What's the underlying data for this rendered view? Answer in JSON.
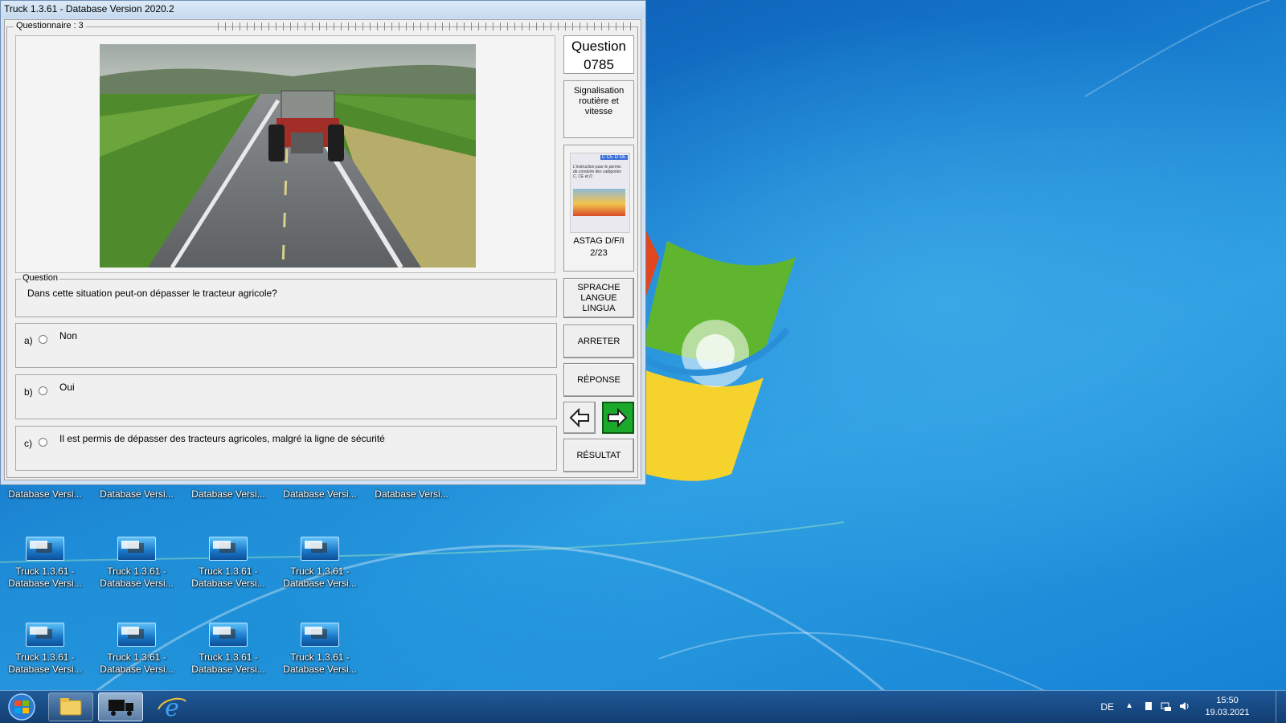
{
  "window": {
    "title": "Truck 1.3.61 - Database Version 2020.2"
  },
  "questionnaire": {
    "legend": "Questionnaire : 3"
  },
  "question_number": {
    "label": "Question",
    "number": "0785"
  },
  "category": {
    "line1": "Signalisation",
    "line2": "routière et vitesse"
  },
  "book": {
    "label_line1": "ASTAG D/F/I",
    "label_line2": "2/23",
    "cover_badge": "C CE D DE",
    "cover_text": "L'instruction pour le permis de conduire des catégories C, CE et D"
  },
  "question": {
    "legend": "Question",
    "text": "Dans cette situation peut-on dépasser le tracteur agricole?"
  },
  "answers": [
    {
      "letter": "a)",
      "text": "Non"
    },
    {
      "letter": "b)",
      "text": "Oui"
    },
    {
      "letter": "c)",
      "text": "Il est permis de dépasser des tracteurs agricoles, malgré la ligne de sécurité"
    }
  ],
  "buttons": {
    "lang_line1": "SPRACHE",
    "lang_line2": "LANGUE",
    "lang_line3": "LINGUA",
    "stop": "ARRETER",
    "answer": "RÉPONSE",
    "result": "RÉSULTAT",
    "prev_icon": "arrow-left-icon",
    "next_icon": "arrow-right-icon"
  },
  "desktop": {
    "partial_icons": [
      {
        "label": "Database Versi..."
      },
      {
        "label": "Database Versi..."
      },
      {
        "label": "Database Versi..."
      },
      {
        "label": "Database Versi..."
      },
      {
        "label": "Database Versi..."
      }
    ],
    "icons_row2": [
      {
        "line1": "Truck 1.3.61 -",
        "line2": "Database Versi..."
      },
      {
        "line1": "Truck 1.3.61 -",
        "line2": "Database Versi..."
      },
      {
        "line1": "Truck 1.3.61 -",
        "line2": "Database Versi..."
      },
      {
        "line1": "Truck 1.3.61 -",
        "line2": "Database Versi..."
      }
    ],
    "icons_row3": [
      {
        "line1": "Truck 1.3.61 -",
        "line2": "Database Versi..."
      },
      {
        "line1": "Truck 1.3.61 -",
        "line2": "Database Versi..."
      },
      {
        "line1": "Truck 1.3.61 -",
        "line2": "Database Versi..."
      },
      {
        "line1": "Truck 1.3.61 -",
        "line2": "Database Versi..."
      }
    ]
  },
  "taskbar": {
    "language": "DE",
    "time": "15:50",
    "date": "19.03.2021"
  },
  "colors": {
    "next_button": "#1ba82b",
    "taskbar": "#1b4f8a"
  }
}
